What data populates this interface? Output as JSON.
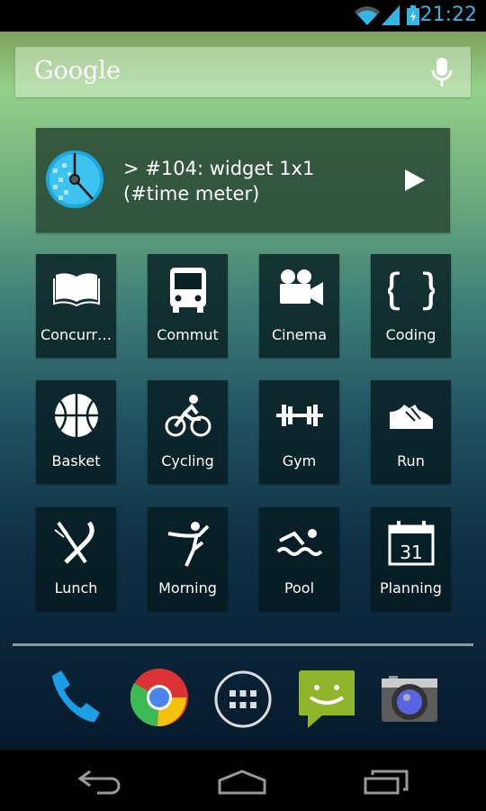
{
  "status_bar": {
    "time": "21:22",
    "icons": [
      "wifi-icon",
      "signal-icon",
      "battery-charging-icon"
    ],
    "accent": "#33b5e5"
  },
  "search": {
    "logo": "Google",
    "icon": "mic-icon"
  },
  "widget": {
    "line1": "> #104: widget 1x1",
    "line2": "(#time meter)",
    "icon": "time-meter-icon",
    "action": "play-icon"
  },
  "tiles": [
    {
      "label": "Concurr…",
      "icon": "book-icon"
    },
    {
      "label": "Commut",
      "icon": "bus-icon"
    },
    {
      "label": "Cinema",
      "icon": "movie-camera-icon"
    },
    {
      "label": "Coding",
      "icon": "braces-icon"
    },
    {
      "label": "Basket",
      "icon": "basketball-icon"
    },
    {
      "label": "Cycling",
      "icon": "cyclist-icon"
    },
    {
      "label": "Gym",
      "icon": "dumbbell-icon"
    },
    {
      "label": "Run",
      "icon": "sneaker-icon"
    },
    {
      "label": "Lunch",
      "icon": "fork-knife-icon"
    },
    {
      "label": "Morning",
      "icon": "yoga-icon"
    },
    {
      "label": "Pool",
      "icon": "swimmer-icon"
    },
    {
      "label": "Planning",
      "icon": "calendar-icon",
      "day": "31"
    }
  ],
  "dock": [
    "phone-icon",
    "chrome-icon",
    "app-drawer-icon",
    "messaging-icon",
    "camera-icon"
  ],
  "nav": [
    "back-icon",
    "home-icon",
    "recents-icon"
  ]
}
